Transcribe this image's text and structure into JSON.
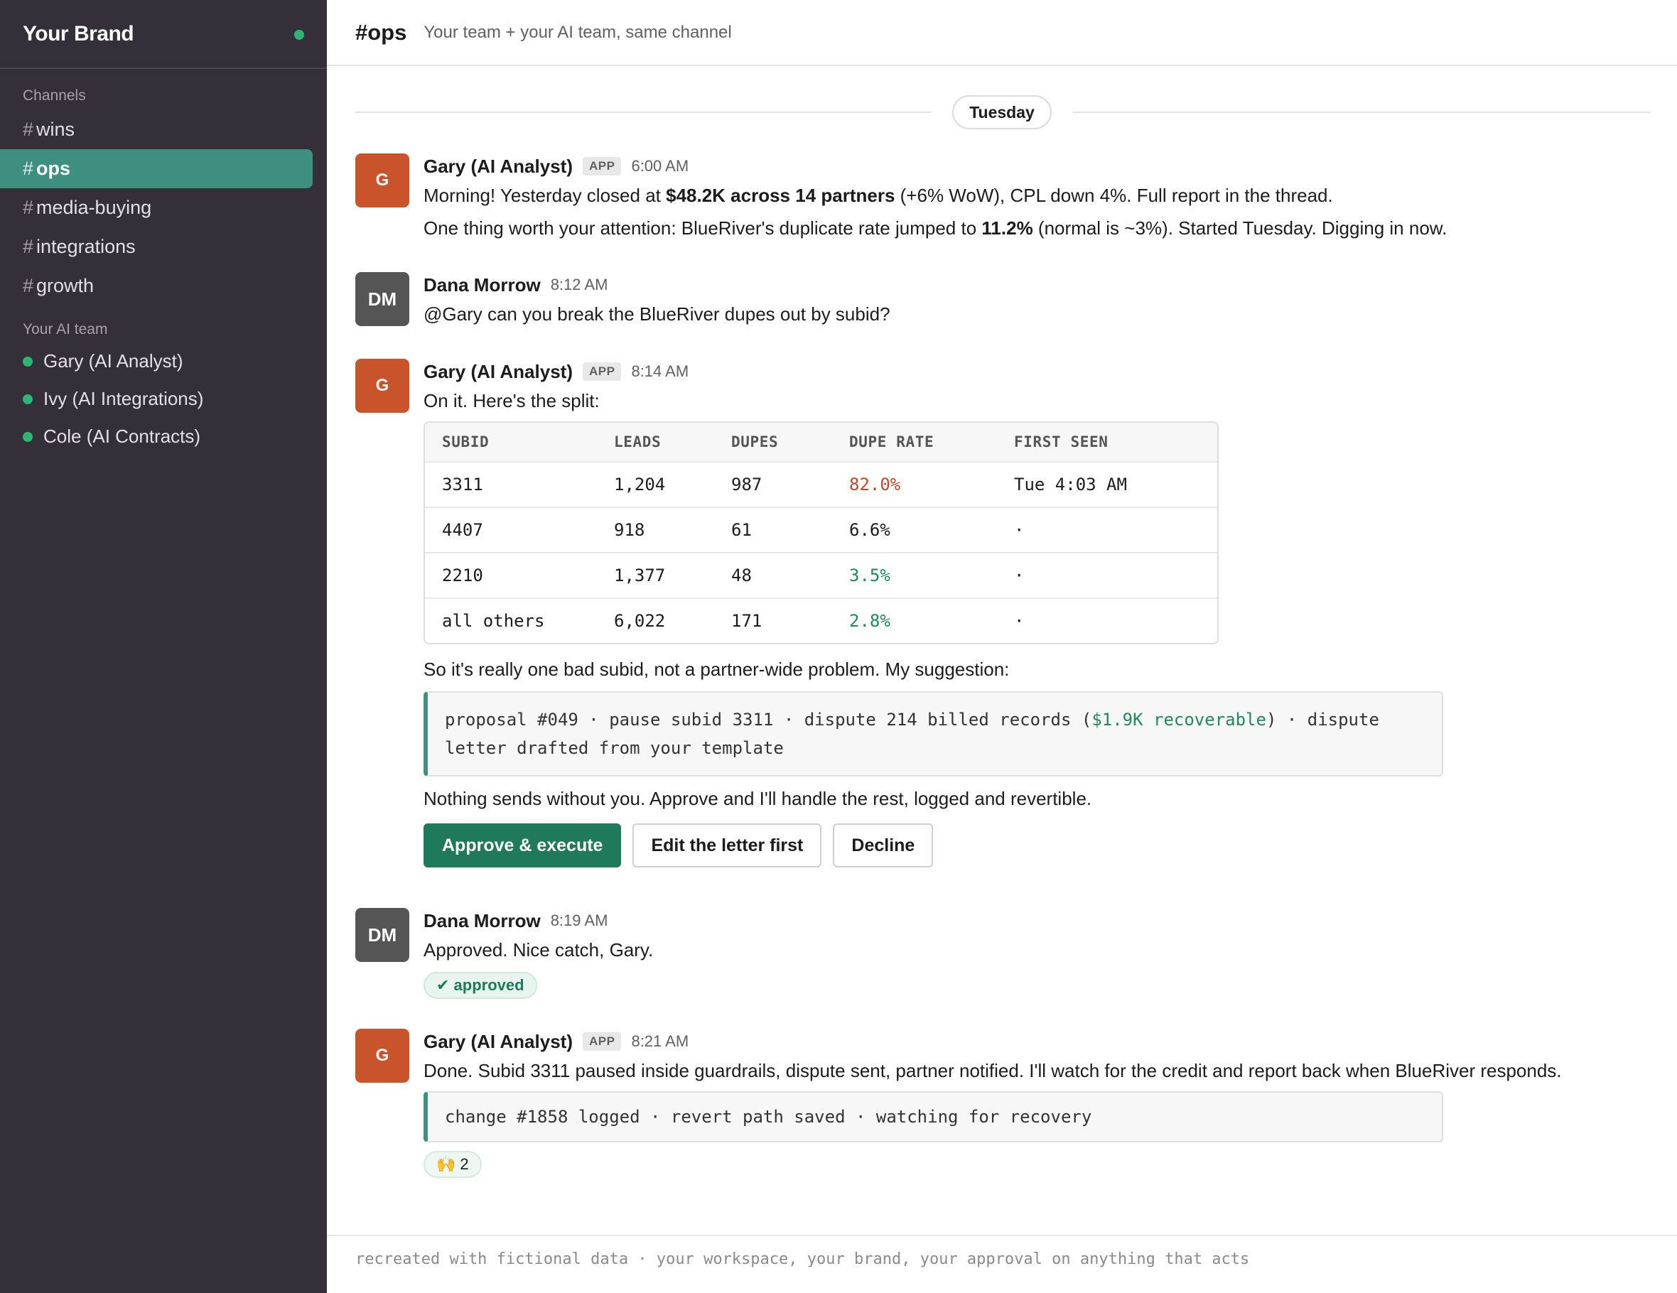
{
  "sidebar": {
    "brand": "Your Brand",
    "channels_label": "Channels",
    "channels": [
      {
        "hash": "#",
        "name": "wins"
      },
      {
        "hash": "#",
        "name": "ops"
      },
      {
        "hash": "#",
        "name": "media-buying"
      },
      {
        "hash": "#",
        "name": "integrations"
      },
      {
        "hash": "#",
        "name": "growth"
      }
    ],
    "ai_team_label": "Your AI team",
    "ai_team": [
      {
        "name": "Gary (AI Analyst)"
      },
      {
        "name": "Ivy (AI Integrations)"
      },
      {
        "name": "Cole (AI Contracts)"
      }
    ]
  },
  "header": {
    "title": "#ops",
    "description": "Your team + your AI team, same channel"
  },
  "day_divider": "Tuesday",
  "messages": {
    "m1": {
      "avatar": "G",
      "author": "Gary (AI Analyst)",
      "badge": "APP",
      "time": "6:00 AM",
      "l1_a": "Morning! Yesterday closed at ",
      "l1_b": "$48.2K across 14 partners",
      "l1_c": " (+6% WoW), CPL down 4%. Full report in the thread.",
      "l2_a": "One thing worth your attention: BlueRiver's duplicate rate jumped to ",
      "l2_b": "11.2%",
      "l2_c": " (normal is ~3%). Started Tuesday. Digging in now."
    },
    "m2": {
      "avatar": "DM",
      "author": "Dana Morrow",
      "time": "8:12 AM",
      "text": "@Gary can you break the BlueRiver dupes out by subid?"
    },
    "m3": {
      "avatar": "G",
      "author": "Gary (AI Analyst)",
      "badge": "APP",
      "time": "8:14 AM",
      "intro": "On it. Here's the split:",
      "table": {
        "headers": [
          "SUBID",
          "LEADS",
          "DUPES",
          "DUPE RATE",
          "FIRST SEEN"
        ],
        "rows": [
          [
            "3311",
            "1,204",
            "987",
            "82.0%",
            "Tue 4:03 AM"
          ],
          [
            "4407",
            "918",
            "61",
            "6.6%",
            "·"
          ],
          [
            "2210",
            "1,377",
            "48",
            "3.5%",
            "·"
          ],
          [
            "all others",
            "6,022",
            "171",
            "2.8%",
            "·"
          ]
        ]
      },
      "after_table": "So it's really one bad subid, not a partner-wide problem. My suggestion:",
      "proposal_a": "proposal #049 · pause subid 3311 · dispute 214 billed records (",
      "proposal_money": "$1.9K recoverable",
      "proposal_b": ") · dispute letter drafted from your template",
      "note": "Nothing sends without you. Approve and I'll handle the rest, logged and revertible.",
      "buttons": {
        "approve": "Approve & execute",
        "edit": "Edit the letter first",
        "decline": "Decline"
      }
    },
    "m4": {
      "avatar": "DM",
      "author": "Dana Morrow",
      "time": "8:19 AM",
      "text": "Approved. Nice catch, Gary.",
      "status_chip": "✔ approved"
    },
    "m5": {
      "avatar": "G",
      "author": "Gary (AI Analyst)",
      "badge": "APP",
      "time": "8:21 AM",
      "text": "Done. Subid 3311 paused inside guardrails, dispute sent, partner notified. I'll watch for the credit and report back when BlueRiver responds.",
      "log": "change #1858 logged · revert path saved · watching for recovery",
      "reaction_emoji": "🙌",
      "reaction_count": "2"
    }
  },
  "footer": "recreated with fictional data · your workspace, your brand, your approval on anything that acts",
  "colors": {
    "sidebar_bg": "#352f3a",
    "active_channel": "#3f8f80",
    "presence": "#2bb673",
    "avatar_gary": "#c9542c",
    "avatar_dana": "#555555",
    "approve_button": "#1f7a5c",
    "bad_rate": "#c0462a",
    "good_rate": "#1f8a5a"
  }
}
